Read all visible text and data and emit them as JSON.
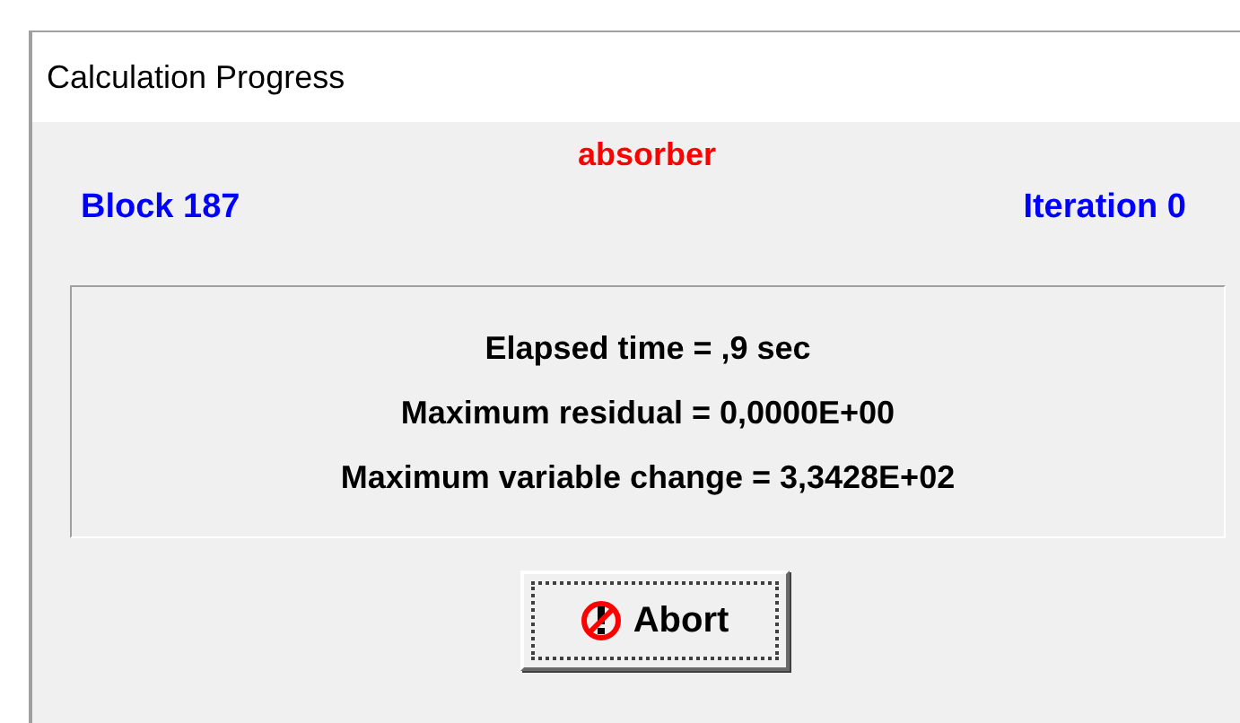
{
  "window": {
    "title": "Calculation Progress"
  },
  "block_name": "absorber",
  "block": "Block 187",
  "iteration": "Iteration 0",
  "stats": [
    "Elapsed time = ,9 sec",
    "Maximum residual = 0,0000E+00",
    "Maximum variable change = 3,3428E+02"
  ],
  "buttons": [
    {
      "label": "Abort",
      "focused": true
    }
  ]
}
